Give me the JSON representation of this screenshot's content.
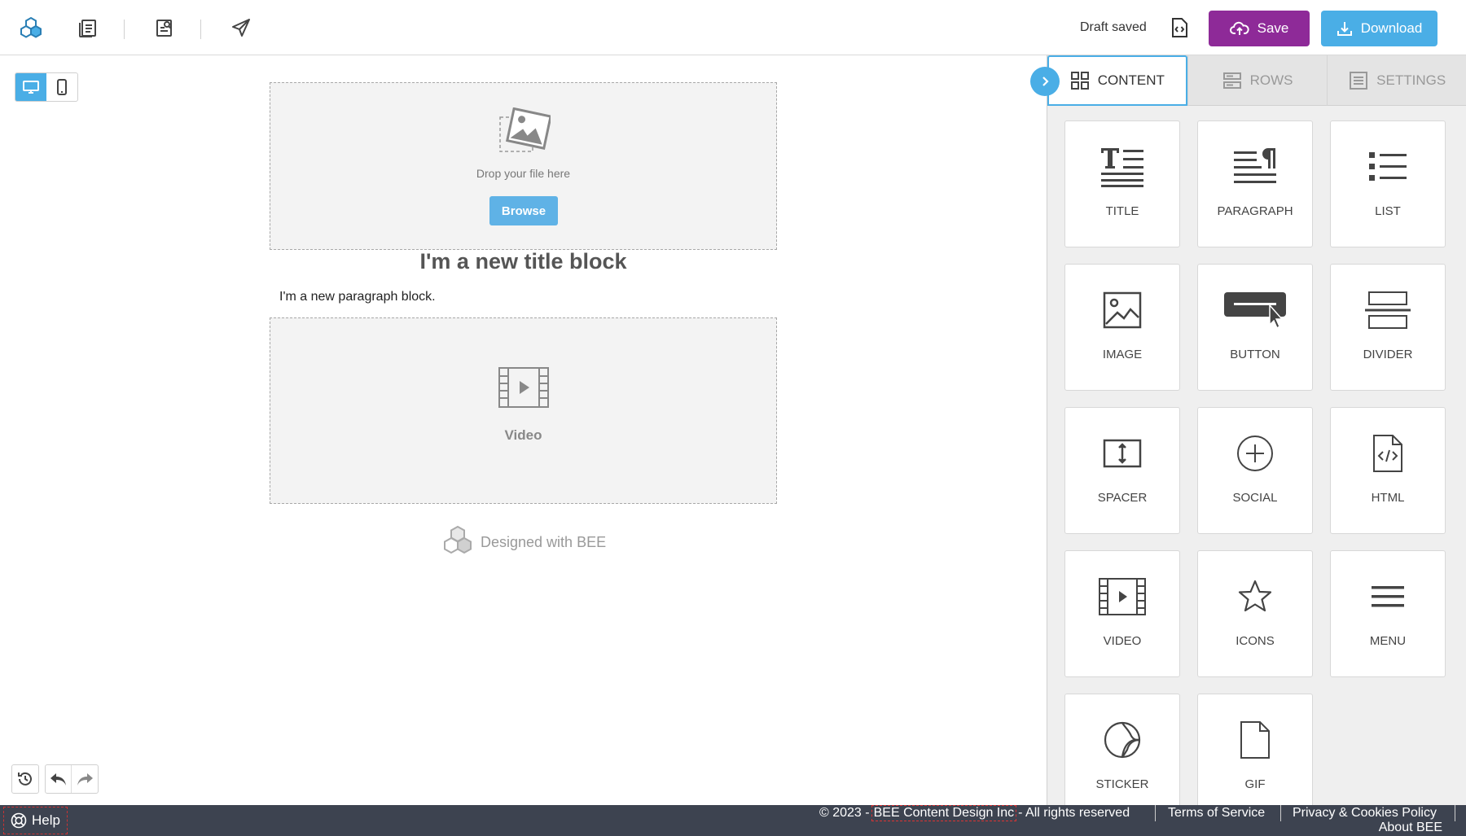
{
  "topbar": {
    "draft_status": "Draft saved",
    "save_label": "Save",
    "download_label": "Download",
    "save_color": "#8e2a98",
    "download_color": "#4aaee6"
  },
  "canvas": {
    "drop_text": "Drop your file here",
    "browse_label": "Browse",
    "title_block": "I'm a new title block",
    "paragraph_block": "I'm a new paragraph block.",
    "video_label": "Video",
    "designed_with": "Designed with BEE"
  },
  "panel": {
    "tabs": [
      {
        "label": "CONTENT",
        "icon": "grid-icon",
        "active": true
      },
      {
        "label": "ROWS",
        "icon": "rows-icon",
        "active": false
      },
      {
        "label": "SETTINGS",
        "icon": "settings-list-icon",
        "active": false
      }
    ],
    "tiles": [
      {
        "label": "TITLE",
        "icon": "title-icon"
      },
      {
        "label": "PARAGRAPH",
        "icon": "paragraph-icon"
      },
      {
        "label": "LIST",
        "icon": "list-icon"
      },
      {
        "label": "IMAGE",
        "icon": "image-icon"
      },
      {
        "label": "BUTTON",
        "icon": "button-icon"
      },
      {
        "label": "DIVIDER",
        "icon": "divider-icon"
      },
      {
        "label": "SPACER",
        "icon": "spacer-icon"
      },
      {
        "label": "SOCIAL",
        "icon": "social-icon"
      },
      {
        "label": "HTML",
        "icon": "html-icon"
      },
      {
        "label": "VIDEO",
        "icon": "video-icon"
      },
      {
        "label": "ICONS",
        "icon": "star-icon"
      },
      {
        "label": "MENU",
        "icon": "menu-icon"
      },
      {
        "label": "STICKER",
        "icon": "sticker-icon"
      },
      {
        "label": "GIF",
        "icon": "gif-icon"
      }
    ]
  },
  "footer": {
    "help_label": "Help",
    "copyright_prefix": "© 2023 -",
    "company": "BEE Content Design Inc",
    "copyright_suffix": "- All rights reserved",
    "terms": "Terms of Service",
    "privacy": "Privacy & Cookies Policy",
    "about": "About BEE"
  }
}
